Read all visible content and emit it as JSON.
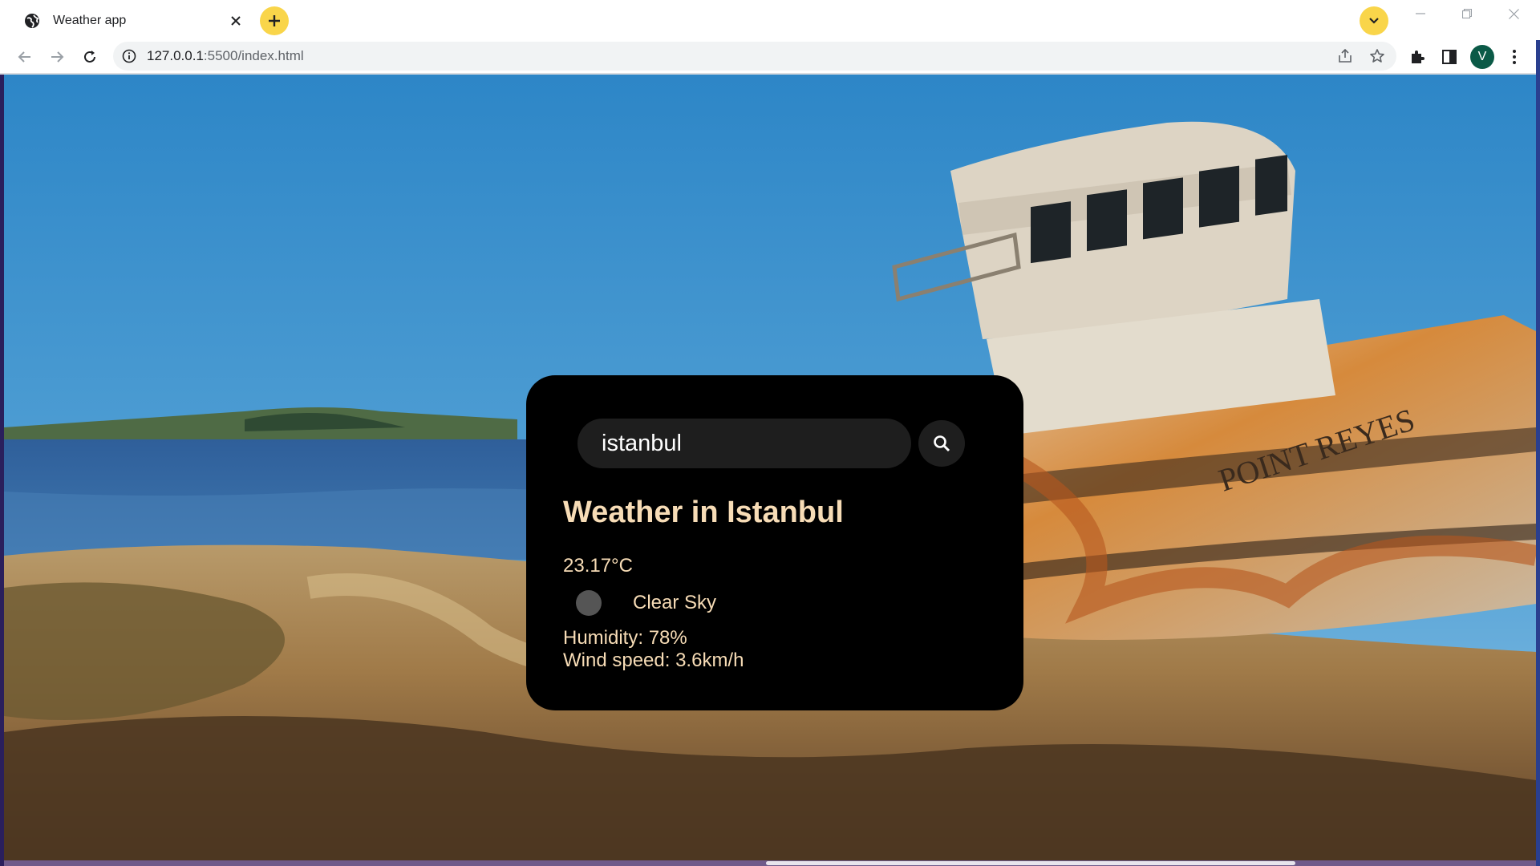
{
  "browser": {
    "tab": {
      "title": "Weather app",
      "favicon": "globe-icon"
    },
    "url": {
      "host": "127.0.0.1",
      "rest": ":5500/index.html"
    },
    "profile_initial": "V",
    "accent_color": "#f9d54a"
  },
  "weather": {
    "search": {
      "value": "istanbul",
      "placeholder": ""
    },
    "city_title": "Weather in Istanbul",
    "temperature": "23.17°C",
    "icon": "weather-icon",
    "description": "Clear Sky",
    "humidity": "Humidity: 78%",
    "wind": "Wind speed: 3.6km/h",
    "text_color": "#f7dcb6",
    "card_color": "#000000"
  },
  "background": {
    "scene": "beach with shipwreck",
    "boat_name": "POINT REYES"
  }
}
